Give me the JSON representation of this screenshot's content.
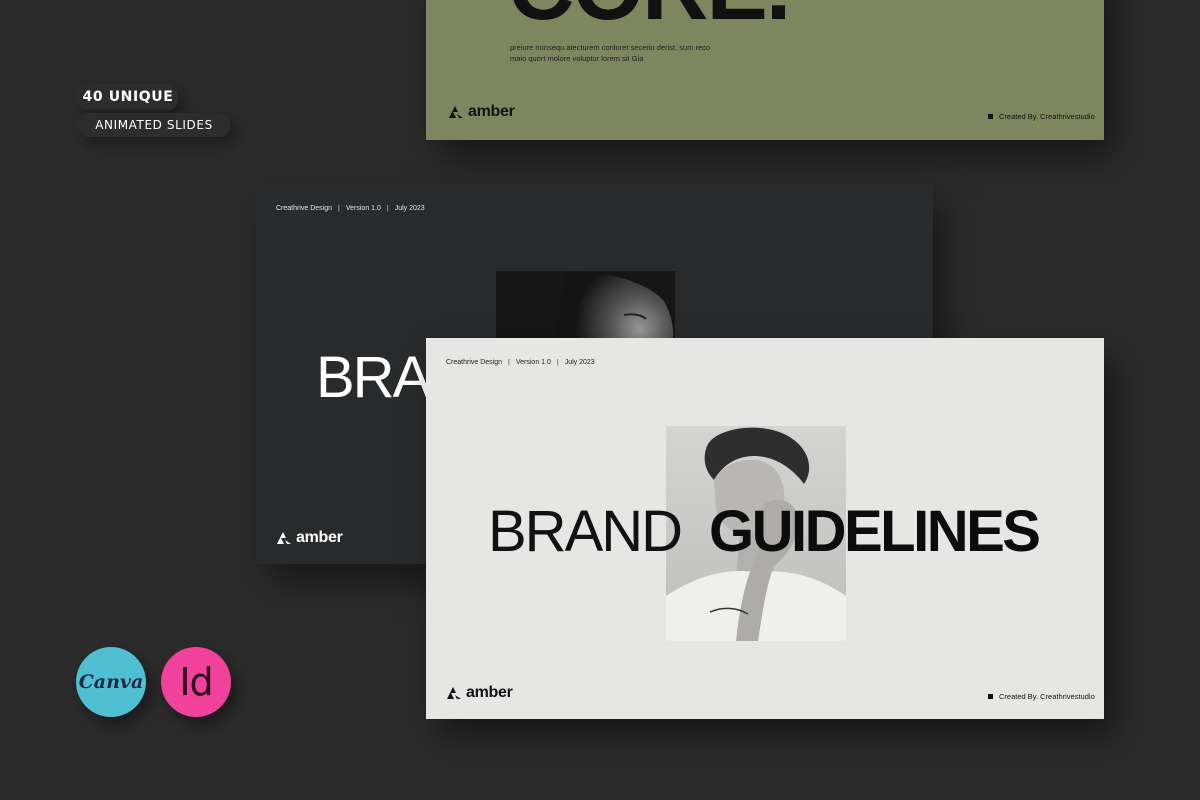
{
  "badges": {
    "unique": "40 UNIQUE",
    "animated": "ANIMATED SLIDES"
  },
  "brand": {
    "logo_text": "amber",
    "credit": "Created By. Creathrivestudio"
  },
  "slide_green": {
    "headline": "CORE.",
    "body_line_1": "preiure nonsequ atecturem conloret secerio derist, sum reco",
    "body_line_2": "maio quort molore voluptur lorem sit Gia",
    "bg_color": "#7e865f"
  },
  "slide_dark": {
    "meta_company": "Creathrive Design",
    "meta_version": "Version 1.0",
    "meta_date": "July 2023",
    "headline": "BRA",
    "bg_color": "#282a2b"
  },
  "slide_light": {
    "meta_company": "Creathrive Design",
    "meta_version": "Version 1.0",
    "meta_date": "July 2023",
    "headline_light": "BRAND",
    "headline_bold": "GUIDELINES",
    "bg_color": "#e6e6e4"
  },
  "apps": {
    "canva_label": "Canva",
    "indesign_label": "Id",
    "canva_color": "#4fbfd1",
    "indesign_color": "#f0429a"
  },
  "icons": [
    "amber-logo-icon",
    "square-bullet-icon"
  ]
}
